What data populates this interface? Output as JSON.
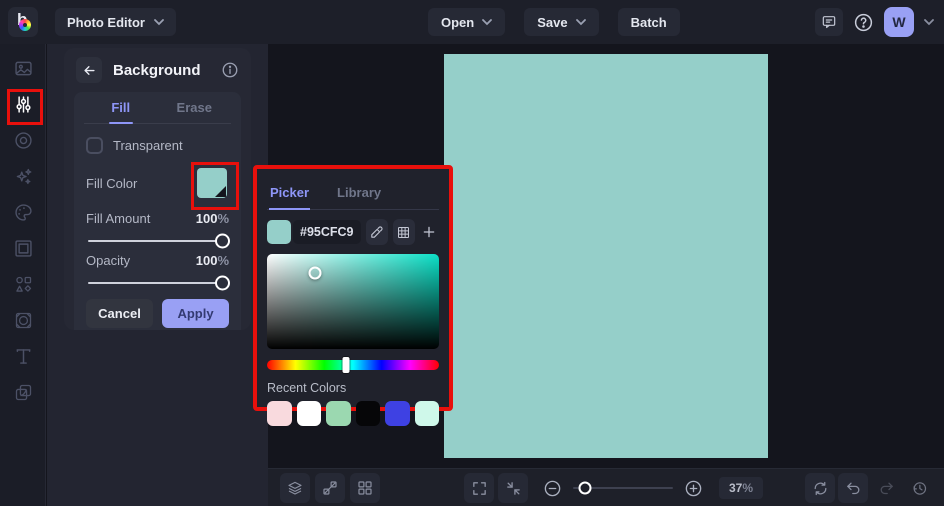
{
  "app": {
    "title": "Photo Editor"
  },
  "topbar": {
    "open_label": "Open",
    "save_label": "Save",
    "batch_label": "Batch",
    "avatar_initial": "W",
    "icons": [
      "feedback-chat-icon",
      "help-icon",
      "chevron-down-icon"
    ]
  },
  "sidebar": {
    "icons": [
      "image-icon",
      "adjust-sliders-icon",
      "eye-icon",
      "effects-sparkles-icon",
      "artsy-palette-icon",
      "frame-icon",
      "graphics-shapes-icon",
      "ornate-frame-icon",
      "text-icon",
      "overlays-icon"
    ],
    "active_index": 1
  },
  "panel": {
    "title": "Background",
    "tabs": {
      "fill": "Fill",
      "erase": "Erase"
    },
    "transparent_label": "Transparent",
    "fill_color_label": "Fill Color",
    "fill_amount": {
      "label": "Fill Amount",
      "value": "100",
      "unit": "%"
    },
    "opacity": {
      "label": "Opacity",
      "value": "100",
      "unit": "%"
    },
    "cancel_label": "Cancel",
    "apply_label": "Apply"
  },
  "picker": {
    "tabs": {
      "picker": "Picker",
      "library": "Library"
    },
    "hex_value": "#95CFC9",
    "current_color": "#95CFC9",
    "gradient_hue_color": "#0bdfc6",
    "hue_handle_position": "46%",
    "sv_cursor": {
      "x": "28%",
      "y": "20%"
    },
    "recent_colors_label": "Recent Colors",
    "recent_colors": [
      "#f9dade",
      "#ffffff",
      "#9bd8b0",
      "#060608",
      "#3e41e3",
      "#cff8ea"
    ],
    "icons": [
      "eyedropper-icon",
      "color-grid-icon",
      "add-color-icon"
    ]
  },
  "canvas": {
    "color": "#95cfc9"
  },
  "statusbar": {
    "zoom_level": "37",
    "zoom_unit": "%",
    "icons": [
      "layers-icon",
      "transform-icon",
      "grid-icon",
      "fullscreen-icon",
      "fit-screen-icon",
      "zoom-out-icon",
      "zoom-in-icon",
      "reset-icon",
      "undo-icon",
      "redo-icon",
      "history-icon"
    ]
  },
  "colors": {
    "accent": "#8e96f7",
    "annotation_red": "#e8100c",
    "mint": "#95cfc9",
    "topbar_bg": "#1d1f29"
  }
}
